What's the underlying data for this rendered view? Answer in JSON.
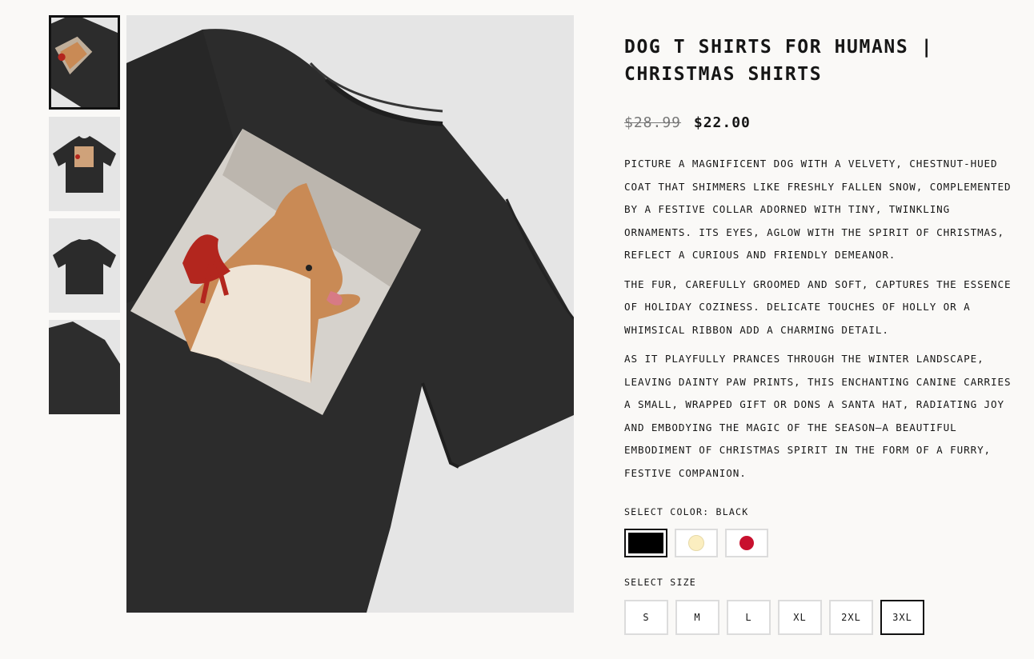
{
  "product": {
    "title": "Dog T Shirts For Humans | Christmas Shirts",
    "price_original": "$28.99",
    "price_sale": "$22.00",
    "description": [
      "Picture a magnificent dog with a velvety, chestnut-hued coat that shimmers like freshly fallen snow, complemented by a festive collar adorned with tiny, twinkling ornaments. Its eyes, aglow with the spirit of Christmas, reflect a curious and friendly demeanor.",
      "The fur, carefully groomed and soft, captures the essence of holiday coziness. Delicate touches of holly or a whimsical ribbon add a charming detail.",
      "As it playfully prances through the winter landscape, leaving dainty paw prints, this enchanting canine carries a small, wrapped gift or dons a Santa hat, radiating joy and embodying the magic of the season—a beautiful embodiment of Christmas spirit in the form of a furry, festive companion."
    ]
  },
  "color_selector": {
    "label": "Select Color: Black",
    "options": [
      {
        "name": "Black",
        "hex": "#000000",
        "selected": true
      },
      {
        "name": "Cream",
        "hex": "#fbeec0",
        "selected": false
      },
      {
        "name": "Red",
        "hex": "#c8102e",
        "selected": false
      }
    ]
  },
  "size_selector": {
    "label": "Select Size",
    "options": [
      "S",
      "M",
      "L",
      "XL",
      "2XL",
      "3XL"
    ],
    "selected": "3XL"
  },
  "gallery": {
    "thumbnails": [
      "dog-shirt-closeup",
      "shirt-front",
      "shirt-back",
      "shirt-folded"
    ],
    "active_index": 0
  },
  "colors": {
    "shirt": "#2c2c2c",
    "background": "#faf9f7",
    "image_bg": "#e5e5e5"
  }
}
